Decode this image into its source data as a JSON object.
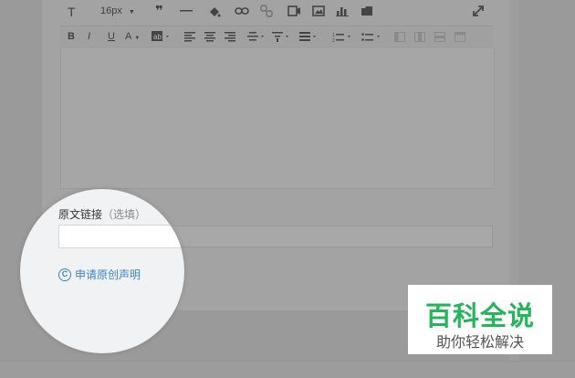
{
  "toolbar": {
    "font_size": "16px"
  },
  "source_link": {
    "label": "原文链接",
    "optional": "（选填）",
    "value": ""
  },
  "original_claim": {
    "icon": "copyright-icon",
    "label": "申请原创声明"
  },
  "watermark": {
    "title": "百科全说",
    "subtitle": "助你轻松解决",
    "color": "#25b55a"
  },
  "colors": {
    "overlay": "#9a9a9a",
    "link": "#3b84c4",
    "magnifier_bg": "#f1f2f4"
  }
}
